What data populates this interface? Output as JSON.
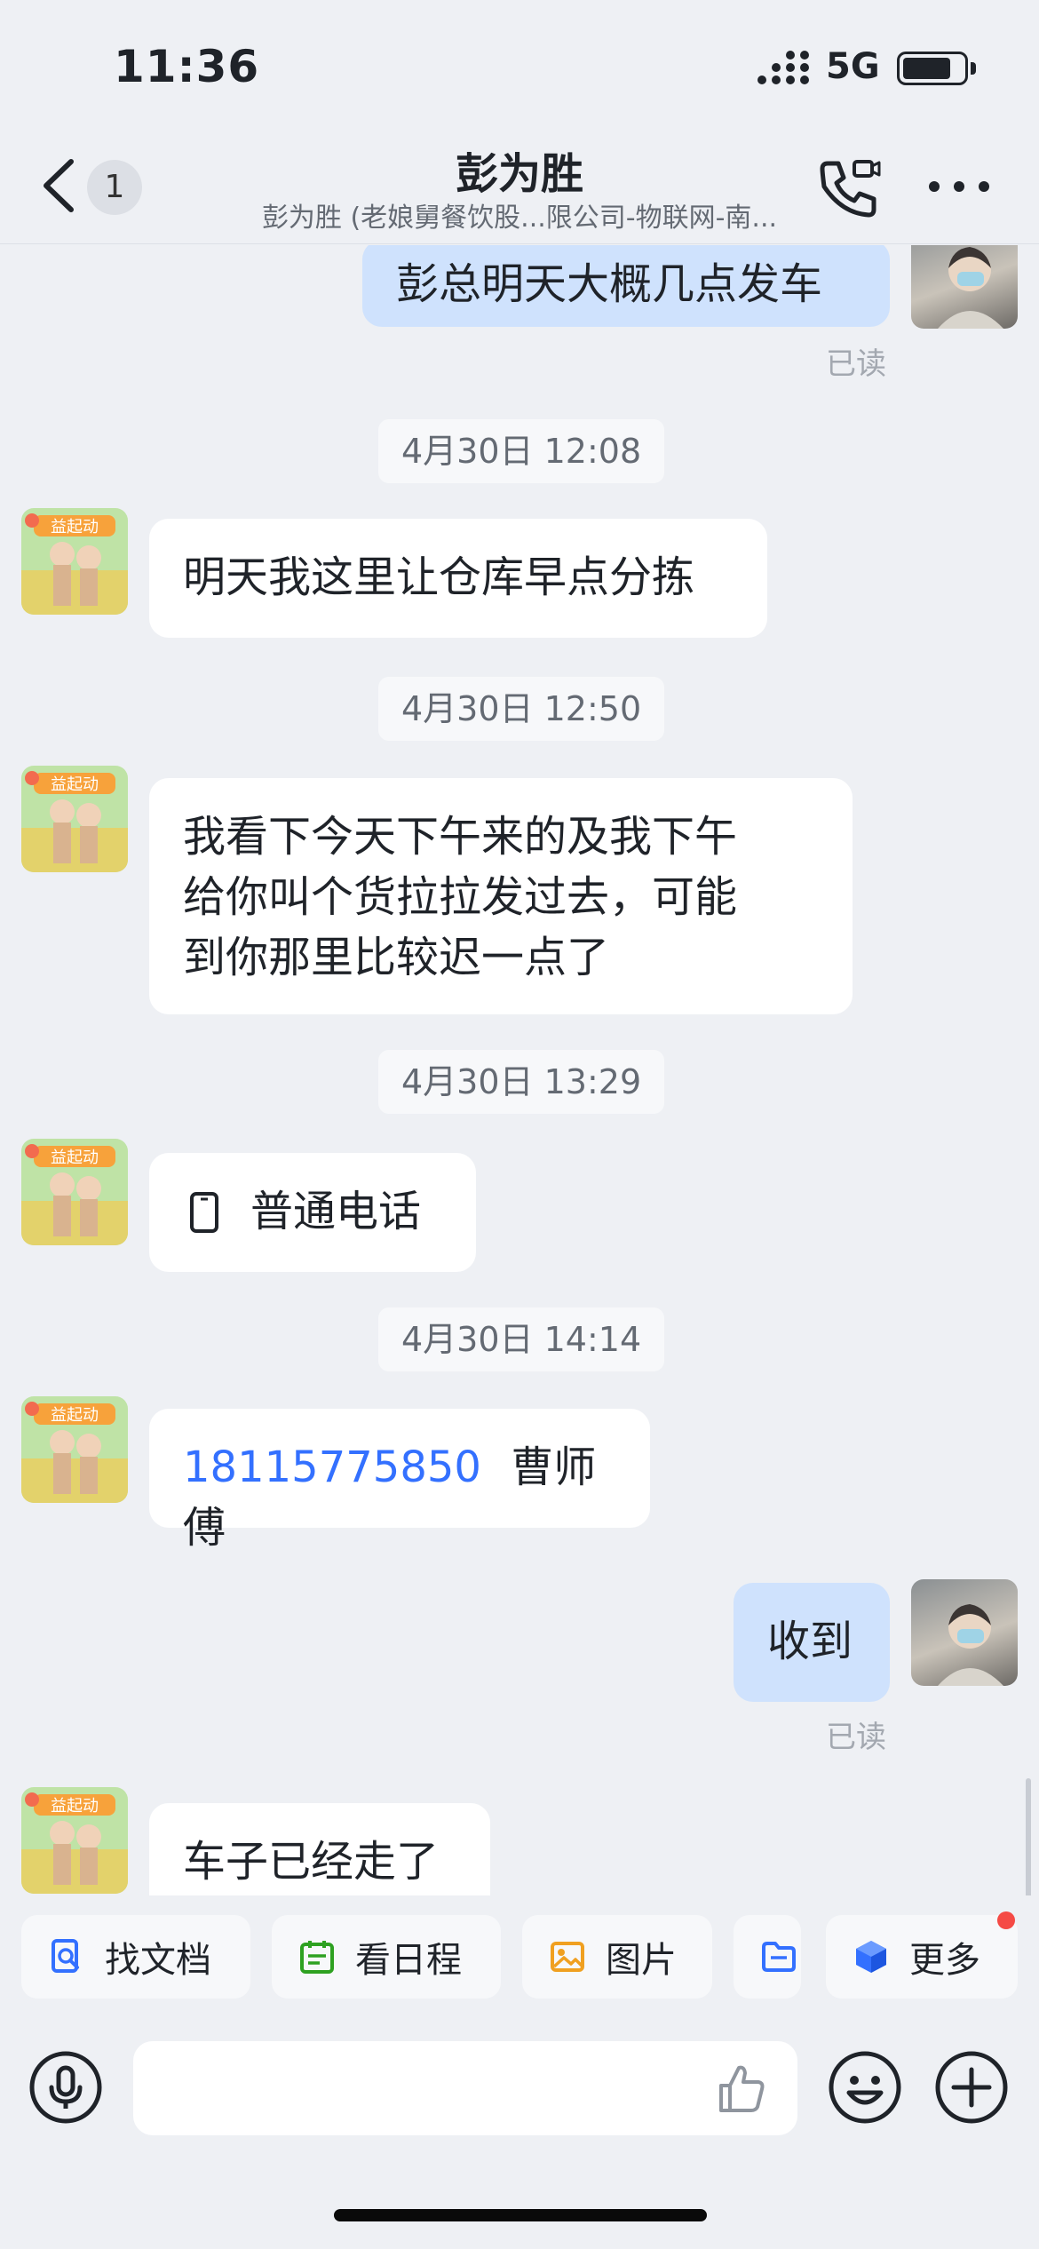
{
  "status_bar": {
    "time": "11:36",
    "network": "5G",
    "battery_level": 0.8
  },
  "nav": {
    "unread_count": "1",
    "title": "彭为胜",
    "subtitle": "彭为胜 (老娘舅餐饮股...限公司-物联网-南..."
  },
  "messages": {
    "m1": {
      "text": "彭总明天大概几点发车",
      "read": "已读"
    },
    "t1": "4月30日 12:08",
    "m2": {
      "text": "明天我这里让仓库早点分拣"
    },
    "t2": "4月30日 12:50",
    "m3": {
      "line1": "我看下今天下午来的及我下午",
      "line2": "给你叫个货拉拉发过去，可能",
      "line3": "到你那里比较迟一点了"
    },
    "t3": "4月30日 13:29",
    "m4": {
      "text": "普通电话",
      "icon": "phone-icon"
    },
    "t4": "4月30日 14:14",
    "m5": {
      "phone": "18115775850",
      "text": "曹师傅"
    },
    "m6": {
      "text": "收到",
      "read": "已读"
    },
    "m7": {
      "text": "车子已经走了"
    }
  },
  "avatar_badge": "益起动",
  "quick_actions": {
    "find_doc": "找文档",
    "schedule": "看日程",
    "images": "图片",
    "more": "更多"
  },
  "input": {
    "placeholder": ""
  },
  "colors": {
    "accent": "#3370ff",
    "outgoing_bubble": "#cfe2fd",
    "background": "#eef0f4"
  }
}
